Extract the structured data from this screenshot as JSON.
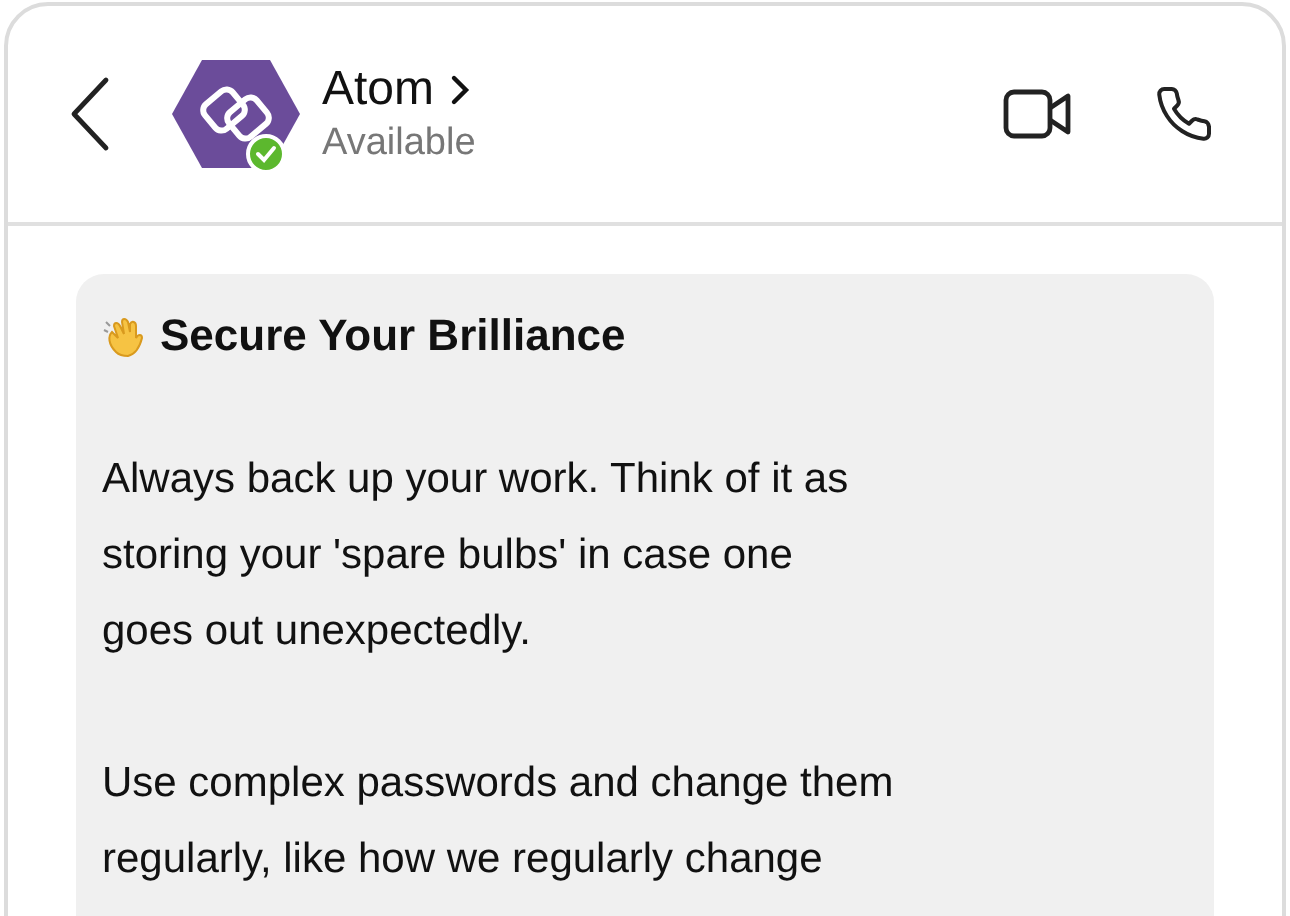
{
  "header": {
    "name": "Atom",
    "status": {
      "text": "Available",
      "online": true
    }
  },
  "message": {
    "title": "Secure Your Brilliance",
    "paragraphs": [
      {
        "lines": [
          "Always back up your work. Think of it as",
          "storing your 'spare bulbs' in case one",
          "goes out unexpectedly."
        ]
      },
      {
        "lines": [
          "Use complex passwords and change them",
          "regularly, like how we regularly change"
        ]
      }
    ]
  }
}
